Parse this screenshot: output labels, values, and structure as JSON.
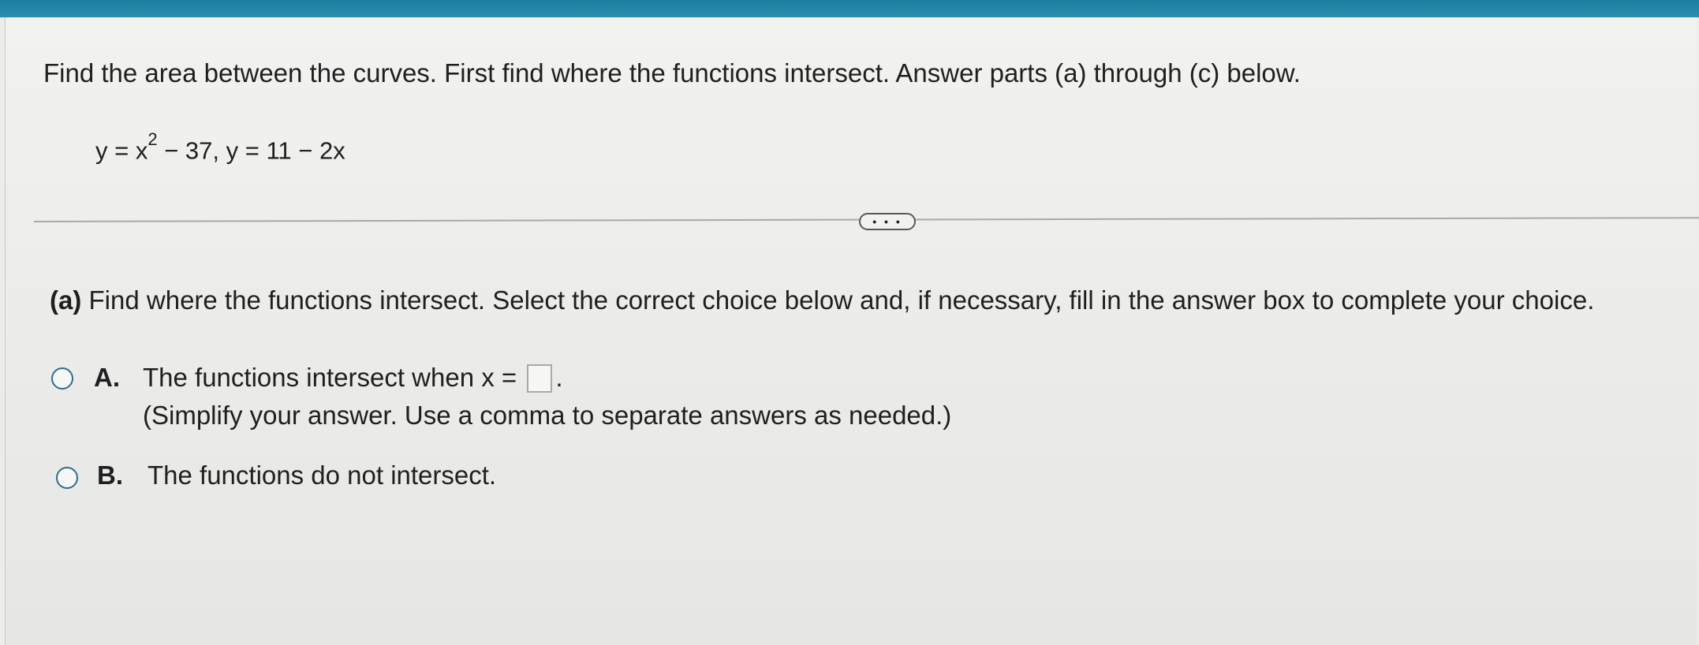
{
  "question": {
    "instruction": "Find the area between the curves. First find where the functions intersect. Answer parts (a) through (c) below.",
    "equation_prefix": "y = x",
    "equation_exponent": "2",
    "equation_suffix": " − 37, y = 11 − 2x"
  },
  "expand_button_label": "• • •",
  "part_a": {
    "label": "(a)",
    "prompt": "Find where the functions intersect. Select the correct choice below and, if necessary, fill in the answer box to complete your choice."
  },
  "choices": [
    {
      "letter": "A.",
      "text_before": "The functions intersect when x =",
      "text_after": ".",
      "note": "(Simplify your answer. Use a comma to separate answers as needed.)",
      "answer_value": ""
    },
    {
      "letter": "B.",
      "text": "The functions do not intersect."
    }
  ],
  "colors": {
    "top_bar": "#1c7fa0",
    "radio_border": "#2e6d90"
  }
}
